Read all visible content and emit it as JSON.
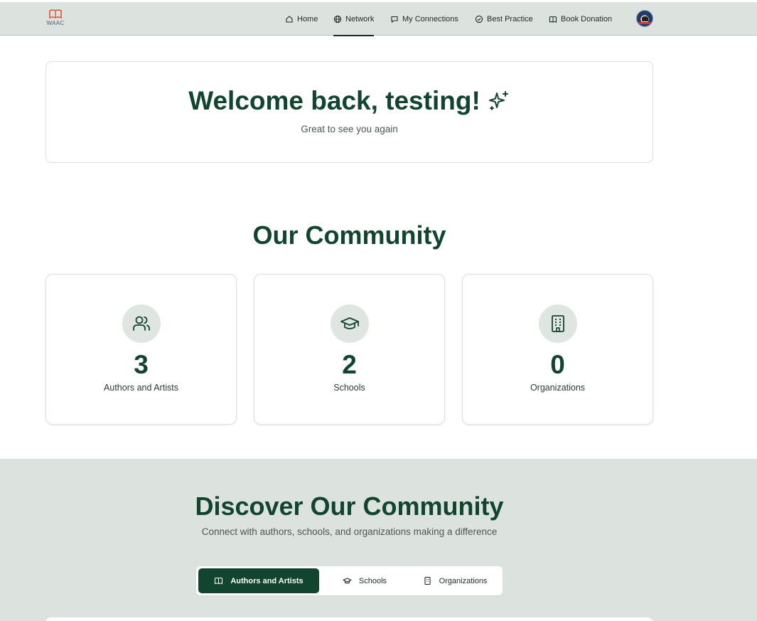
{
  "logo": {
    "text": "WAAC",
    "icon": "open-book-icon"
  },
  "nav": {
    "items": [
      {
        "label": "Home",
        "icon": "home-icon"
      },
      {
        "label": "Network",
        "icon": "globe-icon",
        "active": true
      },
      {
        "label": "My Connections",
        "icon": "message-icon"
      },
      {
        "label": "Best Practice",
        "icon": "check-circle-icon"
      },
      {
        "label": "Book Donation",
        "icon": "book-icon"
      }
    ],
    "avatar_icon": "user-avatar"
  },
  "welcome": {
    "title": "Welcome back, testing!",
    "subtitle": "Great to see you again",
    "icon": "sparkles-icon"
  },
  "community": {
    "title": "Our Community",
    "stats": [
      {
        "value": "3",
        "label": "Authors and Artists",
        "icon": "users-icon"
      },
      {
        "value": "2",
        "label": "Schools",
        "icon": "graduation-cap-icon"
      },
      {
        "value": "0",
        "label": "Organizations",
        "icon": "building-icon"
      }
    ]
  },
  "discover": {
    "title": "Discover Our Community",
    "subtitle": "Connect with authors, schools, and organizations making a difference",
    "tabs": [
      {
        "label": "Authors and Artists",
        "icon": "book-open-icon",
        "active": true
      },
      {
        "label": "Schools",
        "icon": "graduation-cap-icon"
      },
      {
        "label": "Organizations",
        "icon": "building-icon"
      }
    ]
  },
  "colors": {
    "brand_green": "#12452f",
    "nav_bg": "#dce3df",
    "logo_accent": "#e0553a"
  }
}
